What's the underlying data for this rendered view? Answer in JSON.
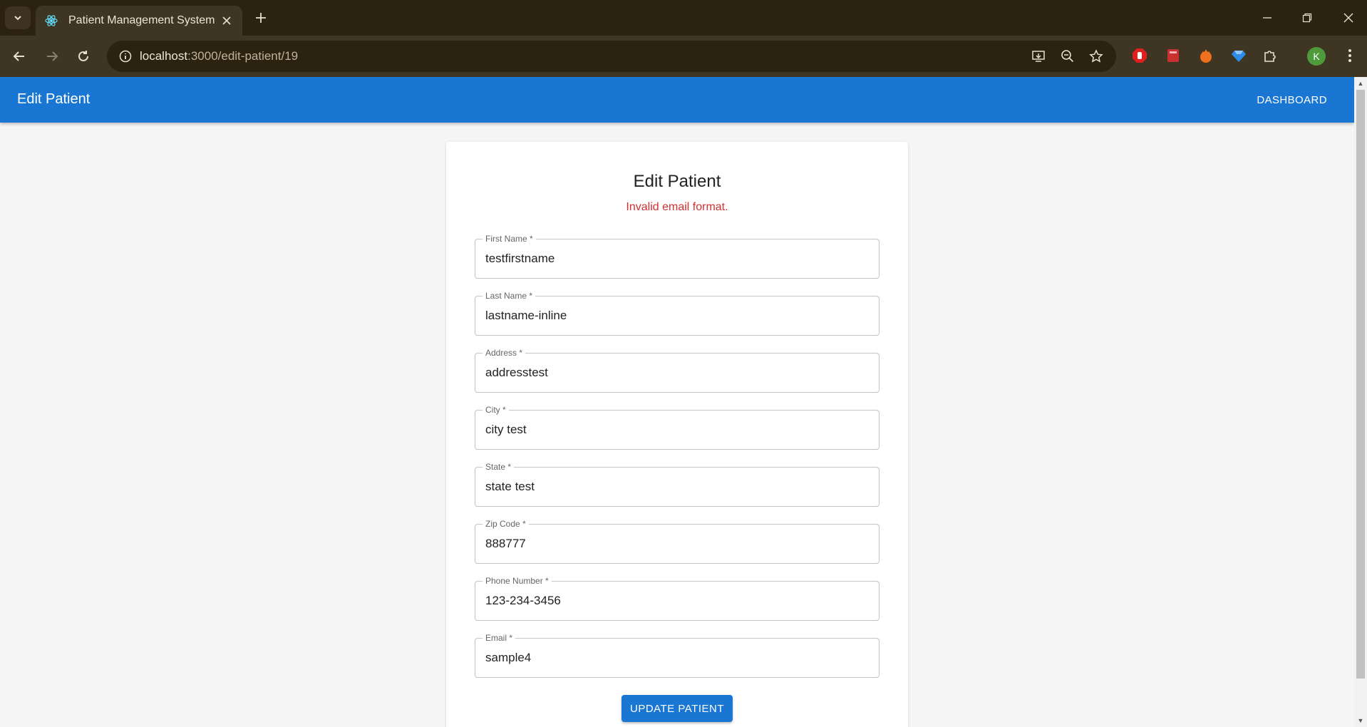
{
  "browser": {
    "tab_title": "Patient Management System",
    "url_host": "localhost",
    "url_path": ":3000/edit-patient/19",
    "profile_initial": "K"
  },
  "appbar": {
    "title": "Edit Patient",
    "dashboard_label": "DASHBOARD"
  },
  "form": {
    "heading": "Edit Patient",
    "error": "Invalid email format.",
    "fields": [
      {
        "label": "First Name *",
        "value": "testfirstname"
      },
      {
        "label": "Last Name *",
        "value": "lastname-inline"
      },
      {
        "label": "Address *",
        "value": "addresstest"
      },
      {
        "label": "City *",
        "value": "city test"
      },
      {
        "label": "State *",
        "value": "state test"
      },
      {
        "label": "Zip Code *",
        "value": "888777"
      },
      {
        "label": "Phone Number *",
        "value": "123-234-3456"
      },
      {
        "label": "Email *",
        "value": "sample4"
      }
    ],
    "submit_label": "UPDATE PATIENT"
  },
  "colors": {
    "primary": "#1976d2",
    "error": "#d32f2f",
    "chrome": "#3e3522"
  }
}
